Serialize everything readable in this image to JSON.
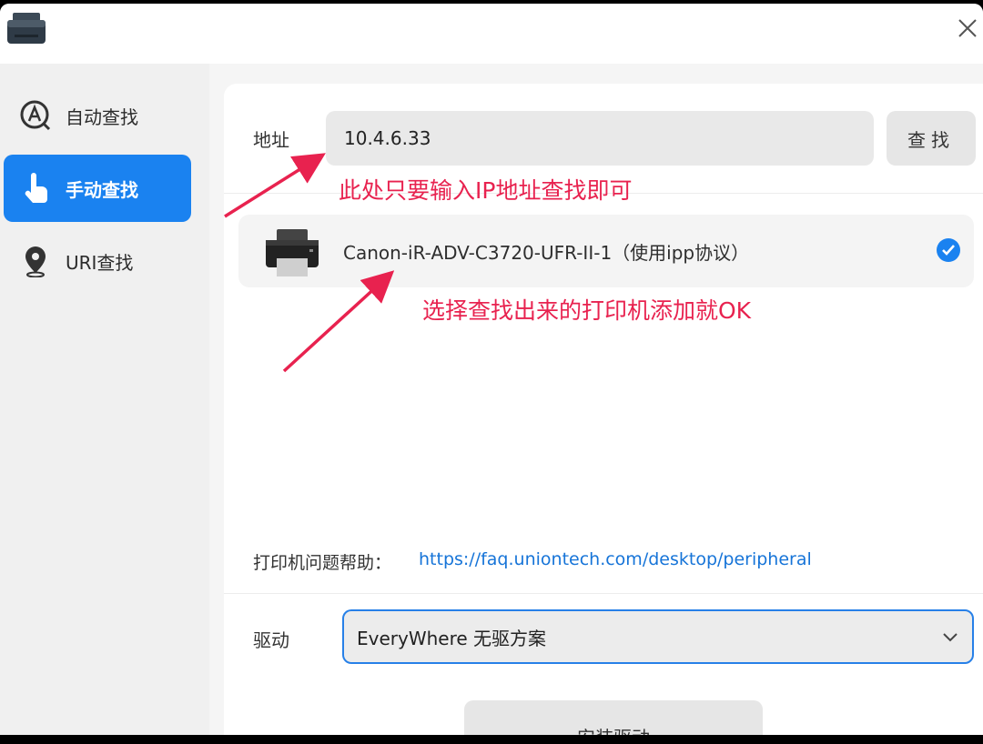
{
  "window": {
    "accent": "#1a82f0"
  },
  "sidebar": {
    "items": [
      {
        "label": "自动查找",
        "icon": "auto-search-icon"
      },
      {
        "label": "手动查找",
        "icon": "hand-pointer-icon",
        "active": true
      },
      {
        "label": "URI查找",
        "icon": "location-pin-icon"
      }
    ]
  },
  "address": {
    "label": "地址",
    "value": "10.4.6.33",
    "find_button": "查找"
  },
  "results": [
    {
      "name": "Canon-iR-ADV-C3720-UFR-II-1（使用ipp协议）",
      "selected": true
    }
  ],
  "annotations": {
    "note1": "此处只要输入IP地址查找即可",
    "note2": "选择查找出来的打印机添加就OK",
    "color": "#e8224f"
  },
  "help": {
    "label": "打印机问题帮助：",
    "link": "https://faq.uniontech.com/desktop/peripheral"
  },
  "driver": {
    "label": "驱动",
    "selected": "EveryWhere 无驱方案"
  },
  "install_button": "安装驱动"
}
